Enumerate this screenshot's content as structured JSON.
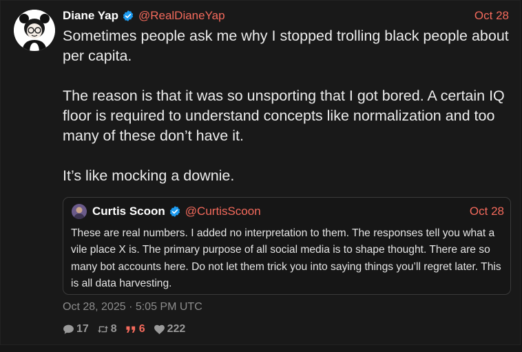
{
  "post": {
    "display_name": "Diane Yap",
    "handle": "@RealDianeYap",
    "date": "Oct 28",
    "paragraphs": [
      "Sometimes people ask me why I stopped trolling black people about per capita.",
      "The reason is that it was so unsporting that I got bored. A certain IQ floor is required to understand concepts like normalization and too many of these don’t have it.",
      "It’s like mocking a downie."
    ],
    "timestamp": "Oct 28, 2025 · 5:05 PM UTC",
    "stats": {
      "replies": "17",
      "retweets": "8",
      "quotes": "6",
      "likes": "222"
    }
  },
  "quoted": {
    "display_name": "Curtis Scoon",
    "handle": "@CurtisScoon",
    "date": "Oct 28",
    "text": "These are real numbers. I added no interpretation to them. The responses tell you what a vile place X is. The primary purpose of all social media is to shape thought. There are so many bot accounts here. Do not let them trick you into saying things you’ll regret later. This is all data harvesting."
  },
  "colors": {
    "accent": "#f46a5c",
    "verified": "#1d9bf0",
    "background": "#191919"
  },
  "icons": [
    "verified-badge-icon",
    "reply-icon",
    "retweet-icon",
    "quote-icon",
    "like-icon"
  ]
}
